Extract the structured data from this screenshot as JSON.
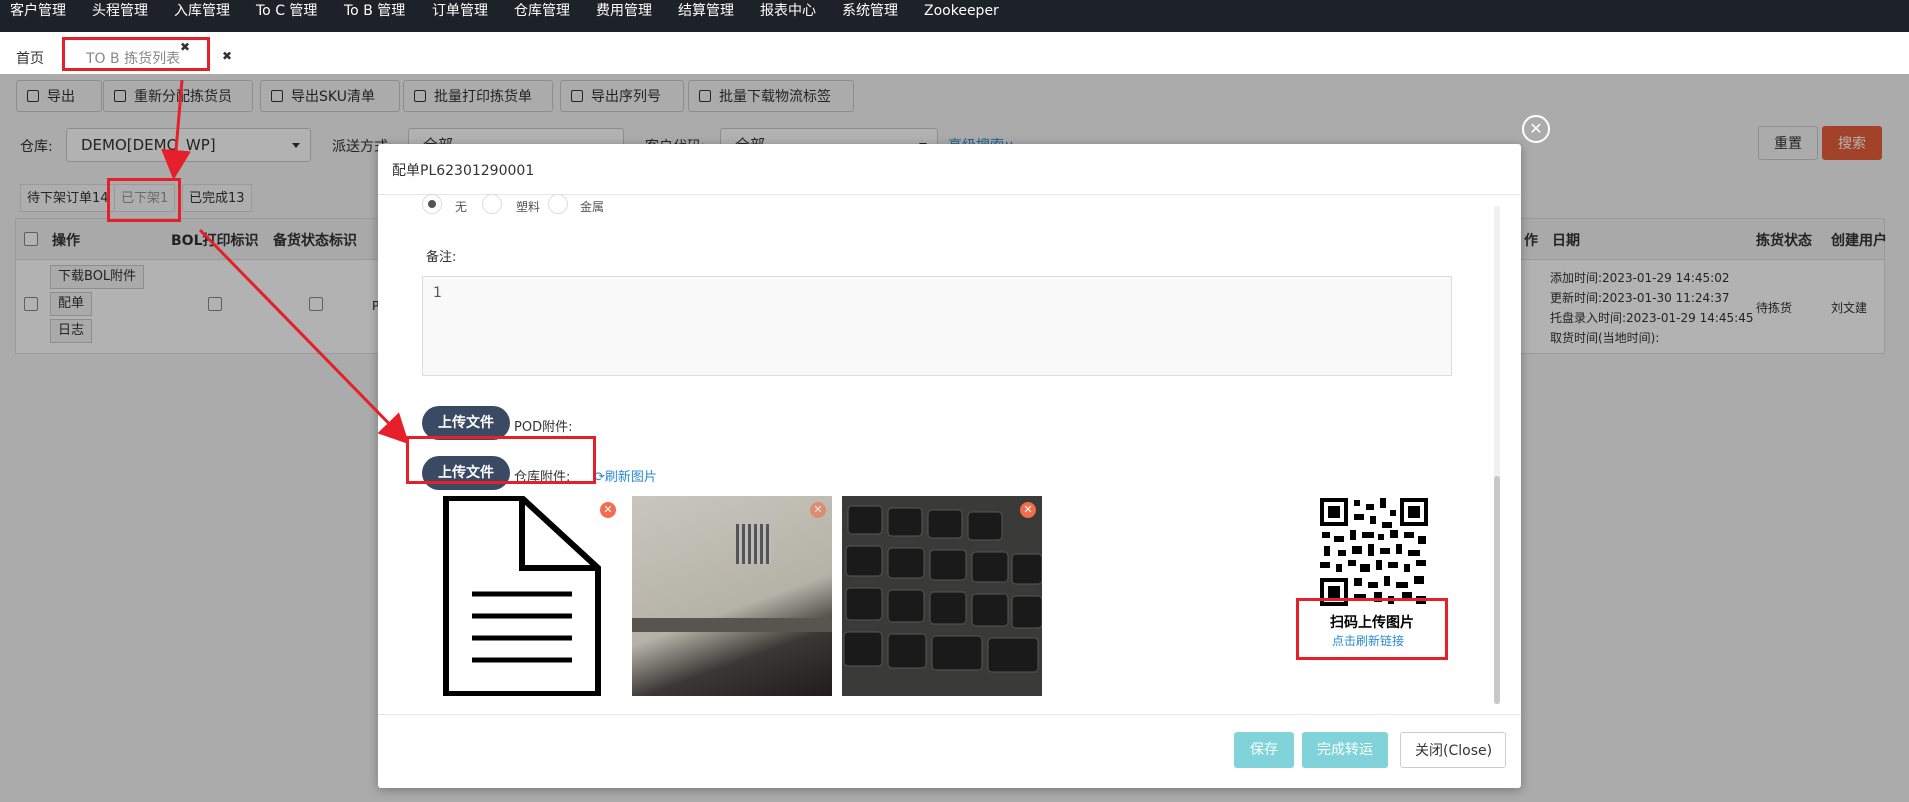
{
  "nav": {
    "items": [
      "客户管理",
      "头程管理",
      "入库管理",
      "To C 管理",
      "To B 管理",
      "订单管理",
      "仓库管理",
      "费用管理",
      "结算管理",
      "报表中心",
      "系统管理",
      "Zookeeper"
    ]
  },
  "tabs": {
    "home": "首页",
    "active": "TO B 拣货列表",
    "close_glyph": "✖"
  },
  "toolbar": {
    "buttons": [
      "导出",
      "重新分配拣货员",
      "导出SKU清单",
      "批量打印拣货单",
      "导出序列号",
      "批量下载物流标签"
    ]
  },
  "filters": {
    "warehouse_label": "仓库:",
    "warehouse_value": "DEMO[DEMO_WP]",
    "dispatch_label": "派送方式:",
    "dispatch_value": "全部",
    "customer_label": "客户代码:",
    "customer_value": "全部",
    "advanced": "高级搜索∨",
    "reset": "重置",
    "search": "搜索"
  },
  "subtabs": [
    "待下架订单14",
    "已下架1",
    "已完成13"
  ],
  "table": {
    "headers": [
      "操作",
      "BOL打印标识",
      "备货状态标识",
      "作",
      "日期",
      "拣货状态",
      "创建用户"
    ],
    "row": {
      "actions": [
        "下载BOL附件",
        "配单",
        "日志"
      ],
      "col_p": "P",
      "dates": [
        "添加时间:2023-01-29 14:45:02",
        "更新时间:2023-01-30 11:24:37",
        "托盘录入时间:2023-01-29 14:45:45",
        "取货时间(当地时间):"
      ],
      "status": "待拣货",
      "user": "刘文建"
    }
  },
  "modal": {
    "title": "配单PL62301290001",
    "radios": [
      "无",
      "塑料",
      "金属"
    ],
    "remark_label": "备注:",
    "remark_value": "1",
    "upload_label": "上传文件",
    "pod_label": "POD附件:",
    "warehouse_attach_label": "仓库附件:",
    "refresh_images": "刷新图片",
    "qr_caption": "扫码上传图片",
    "qr_refresh": "点击刷新链接",
    "footer": {
      "save": "保存",
      "complete": "完成转运",
      "close": "关闭(Close)"
    }
  },
  "colors": {
    "nav_bg": "#1d2228",
    "accent_orange": "#e8603c",
    "upload_btn": "#3a4a63",
    "annotation_red": "#e5202a",
    "footer_btn_teal": "#7fd3d9"
  }
}
